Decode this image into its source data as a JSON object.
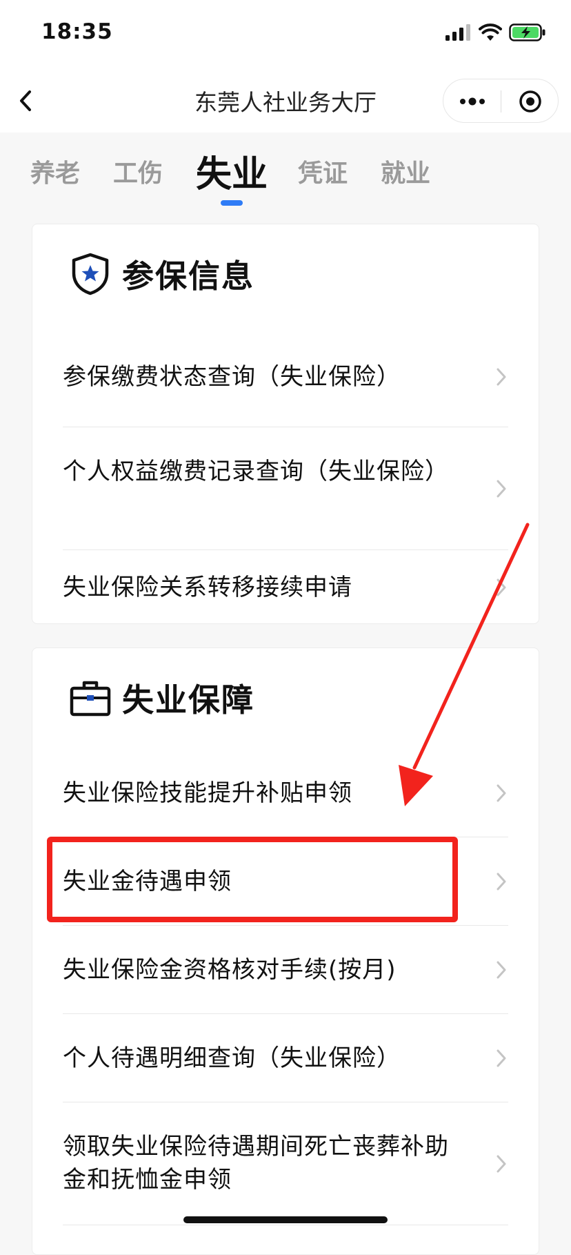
{
  "status_bar": {
    "time": "18:35"
  },
  "nav": {
    "title": "东莞人社业务大厅"
  },
  "tabs": [
    {
      "label": "养老",
      "active": false
    },
    {
      "label": "工伤",
      "active": false
    },
    {
      "label": "失业",
      "active": true
    },
    {
      "label": "凭证",
      "active": false
    },
    {
      "label": "就业",
      "active": false
    }
  ],
  "section1": {
    "icon": "shield-star-icon",
    "title": "参保信息",
    "items": [
      {
        "label": "参保缴费状态查询（失业保险）"
      },
      {
        "label": "个人权益缴费记录查询（失业保险）"
      },
      {
        "label": "失业保险关系转移接续申请"
      }
    ]
  },
  "section2": {
    "icon": "briefcase-icon",
    "title": "失业保障",
    "items": [
      {
        "label": "失业保险技能提升补贴申领"
      },
      {
        "label": "失业金待遇申领",
        "highlighted": true
      },
      {
        "label": "失业保险金资格核对手续(按月)"
      },
      {
        "label": "个人待遇明细查询（失业保险）"
      },
      {
        "label": "领取失业保险待遇期间死亡丧葬补助金和抚恤金申领"
      }
    ]
  },
  "colors": {
    "accent": "#2f7cf6",
    "annotation": "#f2231d",
    "battery": "#4cd964"
  }
}
